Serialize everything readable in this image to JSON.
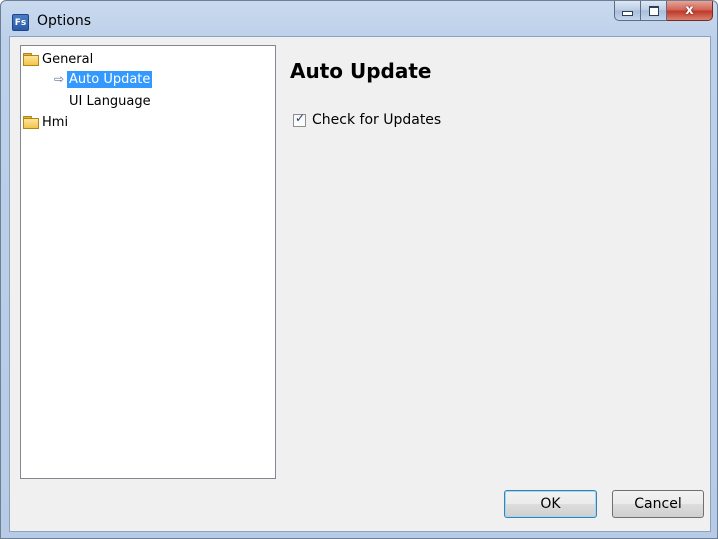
{
  "window": {
    "title": "Options",
    "icon_text": "Fs"
  },
  "title_buttons": {
    "minimize_icon": "minimize-icon",
    "maximize_icon": "maximize-icon",
    "close_icon": "close-icon",
    "close_glyph": "x"
  },
  "tree": {
    "items": [
      {
        "label": "General",
        "icon": "folder-open-icon",
        "level": 0
      },
      {
        "label": "Auto Update",
        "icon": "arrow-right-icon",
        "level": 1,
        "selected": true
      },
      {
        "label": "UI Language",
        "icon": "",
        "level": 1
      },
      {
        "label": "Hmi",
        "icon": "folder-icon",
        "level": 0
      }
    ],
    "arrow_glyph": "⇨"
  },
  "content": {
    "title": "Auto Update",
    "check_for_updates": {
      "label": "Check for Updates",
      "checked": true,
      "tick_glyph": "✓"
    }
  },
  "buttons": {
    "ok_label": "OK",
    "cancel_label": "Cancel"
  },
  "colors": {
    "selection": "#3399ff",
    "window_frame": "#bcd0ea"
  }
}
